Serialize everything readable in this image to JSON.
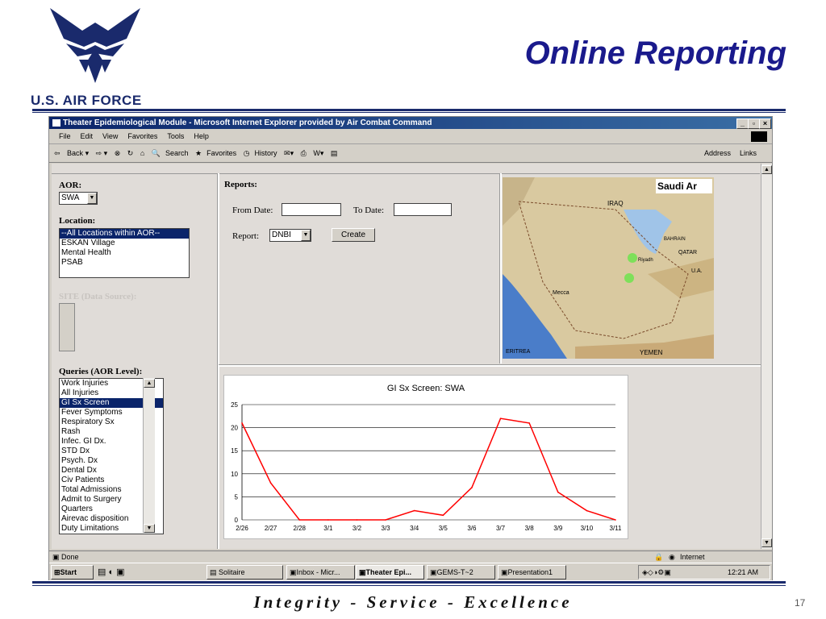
{
  "slide": {
    "title": "Online Reporting",
    "org": "U.S. AIR FORCE",
    "motto": "Integrity - Service - Excellence",
    "page_number": "17"
  },
  "browser": {
    "title": "Theater Epidemiological Module - Microsoft Internet Explorer provided by Air Combat Command",
    "menu": [
      "File",
      "Edit",
      "View",
      "Favorites",
      "Tools",
      "Help"
    ],
    "toolbar": {
      "back": "Back",
      "search": "Search",
      "favorites": "Favorites",
      "history": "History",
      "address": "Address",
      "links": "Links"
    },
    "status": "Done",
    "zone": "Internet"
  },
  "left_panel": {
    "aor_label": "AOR:",
    "aor_value": "SWA",
    "location_label": "Location:",
    "locations": [
      "--All Locations within AOR--",
      "ESKAN Village",
      "Mental Health",
      "PSAB"
    ],
    "site_label": "SITE (Data Source):",
    "queries_label": "Queries (AOR Level):",
    "queries": [
      "Work Injuries",
      "All Injuries",
      "GI Sx Screen",
      "Fever Symptoms",
      "Respiratory Sx",
      "Rash",
      "Infec. GI Dx.",
      "STD Dx",
      "Psych. Dx",
      "Dental Dx",
      "Civ Patients",
      "Total Admissions",
      "Admit to Surgery",
      "Quarters",
      "Airevac disposition",
      "Duty Limitations"
    ]
  },
  "reports": {
    "label": "Reports:",
    "from_label": "From Date:",
    "to_label": "To Date:",
    "report_label": "Report:",
    "report_value": "DNBI",
    "create_label": "Create"
  },
  "map": {
    "title": "Saudi Ar",
    "labels": [
      "IRAQ",
      "YEMEN",
      "QATAR",
      "BAHRAIN",
      "Riyadh",
      "Mecca",
      "ERITREA",
      "U.A."
    ]
  },
  "taskbar": {
    "start": "Start",
    "tasks": [
      "Solitaire",
      "Inbox - Micr...",
      "Theater Epi...",
      "GEMS-T~2",
      "Presentation1"
    ],
    "clock": "12:21 AM"
  },
  "chart_data": {
    "type": "line",
    "title": "GI Sx Screen: SWA",
    "categories": [
      "2/26",
      "2/27",
      "2/28",
      "3/1",
      "3/2",
      "3/3",
      "3/4",
      "3/5",
      "3/6",
      "3/7",
      "3/8",
      "3/9",
      "3/10",
      "3/11"
    ],
    "series": [
      {
        "values": [
          21,
          8,
          0,
          0,
          0,
          0,
          2,
          1,
          7,
          22,
          21,
          6,
          2,
          0
        ]
      }
    ],
    "ylim": [
      0,
      25
    ],
    "yticks": [
      0,
      5,
      10,
      15,
      20,
      25
    ],
    "grid": true,
    "line_color": "#ff0000"
  }
}
